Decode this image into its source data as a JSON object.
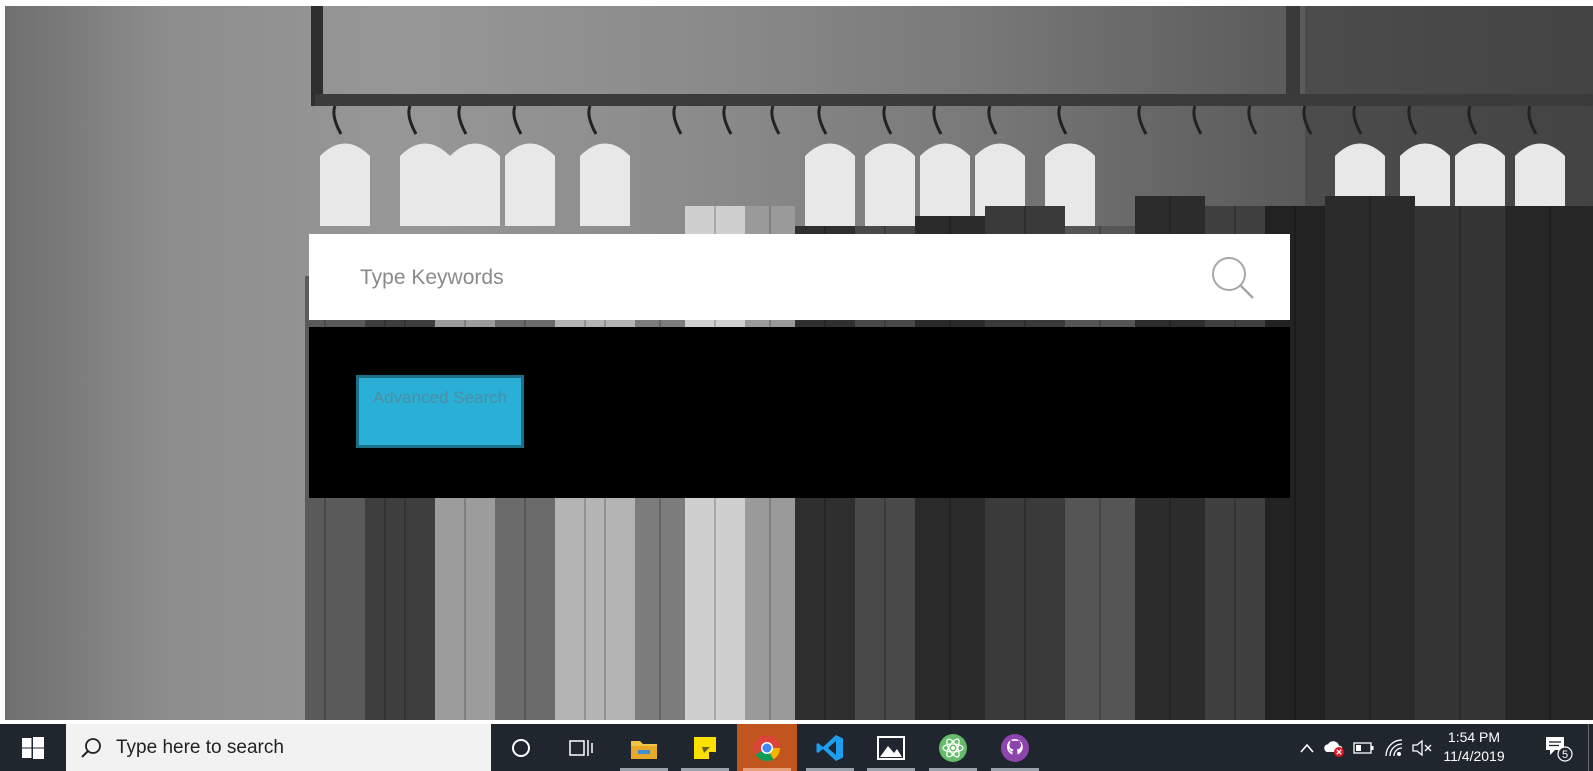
{
  "search": {
    "placeholder": "Type Keywords",
    "search_icon": "magnifier-icon"
  },
  "advanced": {
    "label": "Advanced Search",
    "button_color": "#2aafd6"
  },
  "taskbar": {
    "search_placeholder": "Type here to search",
    "pinned_apps": [
      "cortana",
      "task-view",
      "file-explorer",
      "sticky-notes",
      "chrome",
      "vscode",
      "photos",
      "atom",
      "github-desktop"
    ],
    "active_app": "chrome",
    "tray_icons": [
      "chevron-up",
      "onedrive-error",
      "battery",
      "wifi",
      "volume-muted"
    ],
    "time": "1:54 PM",
    "date": "11/4/2019",
    "notification_count": "5"
  },
  "colors": {
    "taskbar_bg": "#1f262e",
    "panel_bg": "#000000",
    "search_bg": "#ffffff"
  }
}
